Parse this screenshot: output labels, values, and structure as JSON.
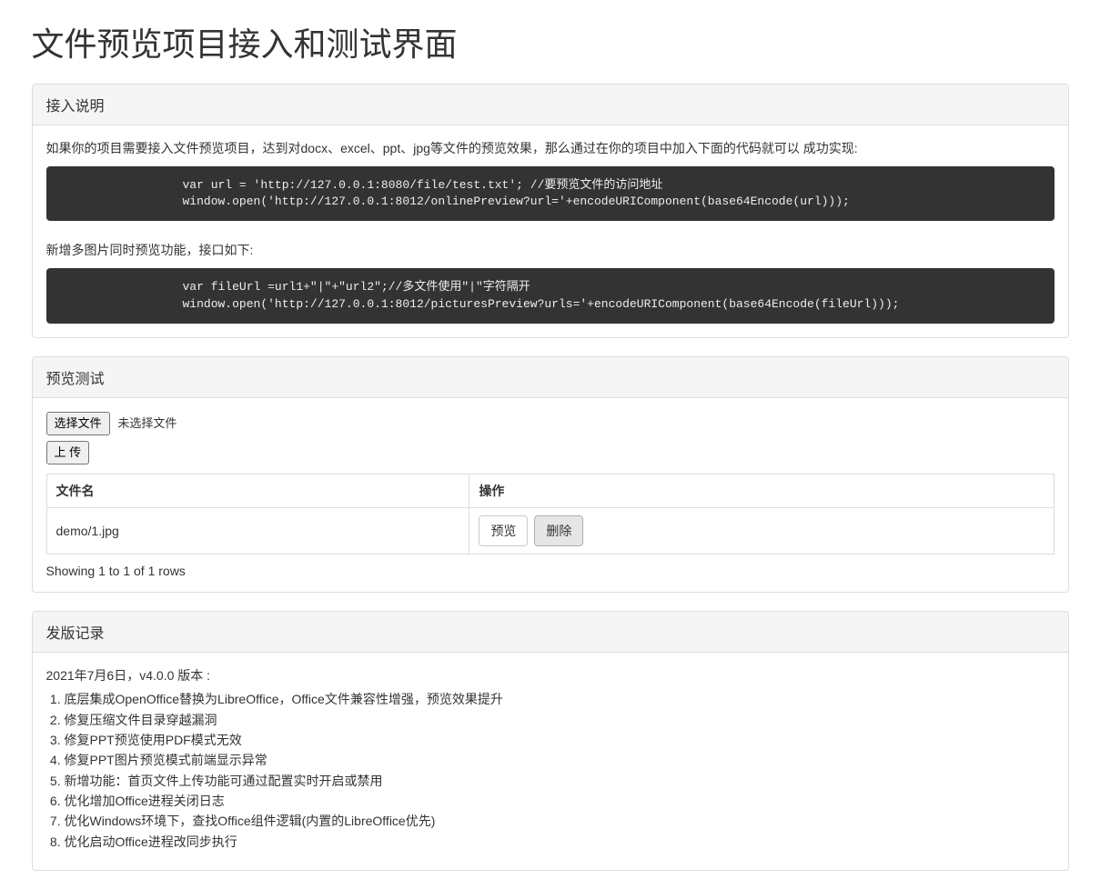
{
  "page_title": "文件预览项目接入和测试界面",
  "access_panel": {
    "heading": "接入说明",
    "intro1": "如果你的项目需要接入文件预览项目，达到对docx、excel、ppt、jpg等文件的预览效果，那么通过在你的项目中加入下面的代码就可以 成功实现:",
    "code1": "var url = 'http://127.0.0.1:8080/file/test.txt'; //要预览文件的访问地址\nwindow.open('http://127.0.0.1:8012/onlinePreview?url='+encodeURIComponent(base64Encode(url)));",
    "intro2": "新增多图片同时预览功能，接口如下:",
    "code2": "var fileUrl =url1+\"|\"+\"url2\";//多文件使用\"|\"字符隔开\nwindow.open('http://127.0.0.1:8012/picturesPreview?urls='+encodeURIComponent(base64Encode(fileUrl)));"
  },
  "test_panel": {
    "heading": "预览测试",
    "choose_file_label": "选择文件",
    "no_file_text": "未选择文件",
    "upload_label": "上 传",
    "table": {
      "col_filename": "文件名",
      "col_action": "操作",
      "rows": [
        {
          "filename": "demo/1.jpg",
          "preview_label": "预览",
          "delete_label": "删除"
        }
      ]
    },
    "pagination_text": "Showing 1 to 1 of 1 rows"
  },
  "release_panel": {
    "heading": "发版记录",
    "release_date": "2021年7月6日，v4.0.0 版本 :",
    "items": [
      "底层集成OpenOffice替换为LibreOffice，Office文件兼容性增强，预览效果提升",
      "修复压缩文件目录穿越漏洞",
      "修复PPT预览使用PDF模式无效",
      "修复PPT图片预览模式前端显示异常",
      "新增功能：首页文件上传功能可通过配置实时开启或禁用",
      "优化增加Office进程关闭日志",
      "优化Windows环境下，查找Office组件逻辑(内置的LibreOffice优先)",
      "优化启动Office进程改同步执行"
    ]
  }
}
